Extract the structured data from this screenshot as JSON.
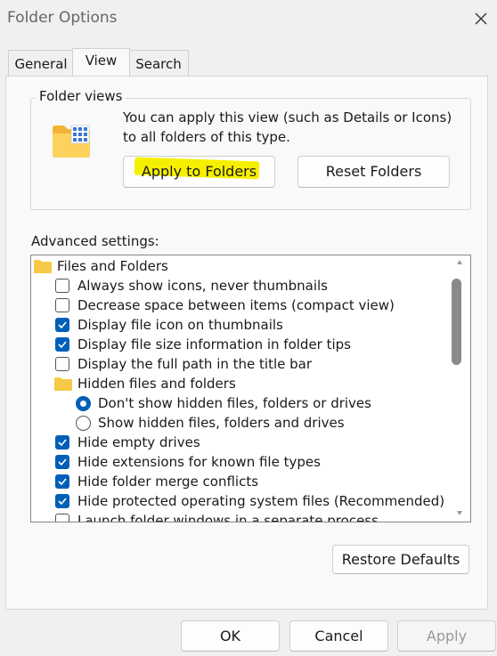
{
  "window": {
    "title": "Folder Options"
  },
  "tabs": [
    {
      "label": "General"
    },
    {
      "label": "View"
    },
    {
      "label": "Search"
    }
  ],
  "folder_views": {
    "group_label": "Folder views",
    "description": "You can apply this view (such as Details or Icons) to all folders of this type.",
    "apply_label": "Apply to Folders",
    "reset_label": "Reset Folders",
    "highlight_color": "#f6f000"
  },
  "advanced": {
    "label": "Advanced settings:",
    "items": [
      {
        "type": "folder",
        "label": "Files and Folders"
      },
      {
        "type": "checkbox",
        "checked": false,
        "label": "Always show icons, never thumbnails"
      },
      {
        "type": "checkbox",
        "checked": false,
        "label": "Decrease space between items (compact view)"
      },
      {
        "type": "checkbox",
        "checked": true,
        "label": "Display file icon on thumbnails"
      },
      {
        "type": "checkbox",
        "checked": true,
        "label": "Display file size information in folder tips"
      },
      {
        "type": "checkbox",
        "checked": false,
        "label": "Display the full path in the title bar"
      },
      {
        "type": "folder",
        "label": "Hidden files and folders"
      },
      {
        "type": "radio",
        "checked": true,
        "label": "Don't show hidden files, folders or drives"
      },
      {
        "type": "radio",
        "checked": false,
        "label": "Show hidden files, folders and drives"
      },
      {
        "type": "checkbox",
        "checked": true,
        "label": "Hide empty drives"
      },
      {
        "type": "checkbox",
        "checked": true,
        "label": "Hide extensions for known file types"
      },
      {
        "type": "checkbox",
        "checked": true,
        "label": "Hide folder merge conflicts"
      },
      {
        "type": "checkbox",
        "checked": true,
        "label": "Hide protected operating system files (Recommended)"
      },
      {
        "type": "checkbox",
        "checked": false,
        "label": "Launch folder windows in a separate process"
      }
    ]
  },
  "restore_label": "Restore Defaults",
  "footer": {
    "ok_label": "OK",
    "cancel_label": "Cancel",
    "apply_label": "Apply"
  },
  "colors": {
    "accent": "#005fb8",
    "folder": "#f7c948"
  }
}
